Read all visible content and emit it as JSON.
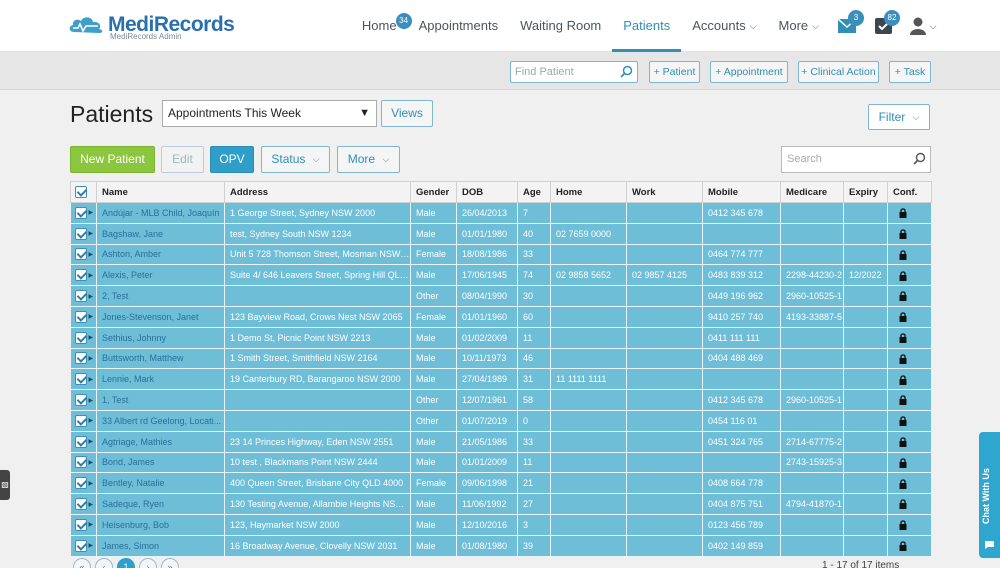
{
  "app": {
    "brand": "MediRecords",
    "brand_sub": "MediRecords Admin"
  },
  "nav": {
    "items": [
      {
        "label": "Home",
        "badge": "34"
      },
      {
        "label": "Appointments"
      },
      {
        "label": "Waiting Room"
      },
      {
        "label": "Patients",
        "active": true
      },
      {
        "label": "Accounts",
        "dropdown": true
      },
      {
        "label": "More",
        "dropdown": true
      }
    ],
    "mail_badge": "3",
    "tasks_badge": "82"
  },
  "actionbar": {
    "find_placeholder": "Find Patient",
    "buttons": [
      "+ Patient",
      "+ Appointment",
      "+ Clinical Action",
      "+ Task"
    ]
  },
  "page": {
    "title": "Patients",
    "view_selected": "Appointments This Week",
    "views_label": "Views",
    "filter_label": "Filter"
  },
  "toolbar": {
    "new_patient": "New Patient",
    "edit": "Edit",
    "opv": "OPV",
    "status": "Status",
    "more": "More",
    "search_placeholder": "Search"
  },
  "table": {
    "headers": [
      "Name",
      "Address",
      "Gender",
      "DOB",
      "Age",
      "Home",
      "Work",
      "Mobile",
      "Medicare",
      "Expiry",
      "Conf."
    ],
    "rows": [
      {
        "name": "Andújar - MLB Child, Joaquín",
        "address": "1 George Street, Sydney NSW 2000",
        "gender": "Male",
        "dob": "26/04/2013",
        "age": "7",
        "home": "",
        "work": "",
        "mobile": "0412 345 678",
        "medicare": "",
        "expiry": ""
      },
      {
        "name": "Bagshaw, Jane",
        "address": "test, Sydney South NSW 1234",
        "gender": "Male",
        "dob": "01/01/1980",
        "age": "40",
        "home": "02 7659 0000",
        "work": "",
        "mobile": "",
        "medicare": "",
        "expiry": ""
      },
      {
        "name": "Ashton, Amber",
        "address": "Unit 5 728 Thomson Street, Mosman NSW ...",
        "gender": "Female",
        "dob": "18/08/1986",
        "age": "33",
        "home": "",
        "work": "",
        "mobile": "0464 774 777",
        "medicare": "",
        "expiry": ""
      },
      {
        "name": "Alexis, Peter",
        "address": "Suite 4/ 646 Leavers Street, Spring Hill QLD ...",
        "gender": "Male",
        "dob": "17/06/1945",
        "age": "74",
        "home": "02 9858 5652",
        "work": "02 9857 4125",
        "mobile": "0483 839 312",
        "medicare": "2298-44230-2",
        "expiry": "12/2022"
      },
      {
        "name": "2, Test",
        "address": "",
        "gender": "Other",
        "dob": "08/04/1990",
        "age": "30",
        "home": "",
        "work": "",
        "mobile": "0449 196 962",
        "medicare": "2960-10525-1",
        "expiry": ""
      },
      {
        "name": "Jones-Stevenson, Janet",
        "address": "123 Bayview Road, Crows Nest NSW 2065",
        "gender": "Female",
        "dob": "01/01/1960",
        "age": "60",
        "home": "",
        "work": "",
        "mobile": "9410 257 740",
        "medicare": "4193-33887-5",
        "expiry": ""
      },
      {
        "name": "Sethius, Johnny",
        "address": "1 Demo St, Picnic Point NSW 2213",
        "gender": "Male",
        "dob": "01/02/2009",
        "age": "11",
        "home": "",
        "work": "",
        "mobile": "0411 111 111",
        "medicare": "",
        "expiry": ""
      },
      {
        "name": "Buttsworth, Matthew",
        "address": "1 Smith Street, Smithfield NSW 2164",
        "gender": "Male",
        "dob": "10/11/1973",
        "age": "46",
        "home": "",
        "work": "",
        "mobile": "0404 488 469",
        "medicare": "",
        "expiry": ""
      },
      {
        "name": "Lennie, Mark",
        "address": "19 Canterbury RD, Barangaroo NSW 2000",
        "gender": "Male",
        "dob": "27/04/1989",
        "age": "31",
        "home": "11 1111 1111",
        "work": "",
        "mobile": "",
        "medicare": "",
        "expiry": ""
      },
      {
        "name": "1, Test",
        "address": "",
        "gender": "Other",
        "dob": "12/07/1961",
        "age": "58",
        "home": "",
        "work": "",
        "mobile": "0412 345 678",
        "medicare": "2960-10525-1",
        "expiry": ""
      },
      {
        "name": "33 Albert rd Geelong, Locati...",
        "address": "",
        "gender": "Other",
        "dob": "01/07/2019",
        "age": "0",
        "home": "",
        "work": "",
        "mobile": "0454 116 01",
        "medicare": "",
        "expiry": ""
      },
      {
        "name": "Agtriage, Mathies",
        "address": "23 14 Princes Highway, Eden NSW 2551",
        "gender": "Male",
        "dob": "21/05/1986",
        "age": "33",
        "home": "",
        "work": "",
        "mobile": "0451 324 765",
        "medicare": "2714-67775-2",
        "expiry": ""
      },
      {
        "name": "Bond, James",
        "address": "10 test , Blackmans Point NSW 2444",
        "gender": "Male",
        "dob": "01/01/2009",
        "age": "11",
        "home": "",
        "work": "",
        "mobile": "",
        "medicare": "2743-15925-3",
        "expiry": ""
      },
      {
        "name": "Bentley, Natalie",
        "address": "400 Queen Street, Brisbane City QLD 4000",
        "gender": "Female",
        "dob": "09/06/1998",
        "age": "21",
        "home": "",
        "work": "",
        "mobile": "0408 664 778",
        "medicare": "",
        "expiry": ""
      },
      {
        "name": "Sadeque, Ryen",
        "address": "130 Testing Avenue, Allambie Heights NSW ...",
        "gender": "Male",
        "dob": "11/06/1992",
        "age": "27",
        "home": "",
        "work": "",
        "mobile": "0404 875 751",
        "medicare": "4794-41870-1",
        "expiry": ""
      },
      {
        "name": "Heisenburg, Bob",
        "address": "123, Haymarket NSW 2000",
        "gender": "Male",
        "dob": "12/10/2016",
        "age": "3",
        "home": "",
        "work": "",
        "mobile": "0123 456 789",
        "medicare": "",
        "expiry": ""
      },
      {
        "name": "James, Simon",
        "address": "16 Broadway Avenue, Clovelly NSW 2031",
        "gender": "Male",
        "dob": "01/08/1980",
        "age": "39",
        "home": "",
        "work": "",
        "mobile": "0402 149 859",
        "medicare": "",
        "expiry": ""
      }
    ]
  },
  "pagination": {
    "pages": [
      "«",
      "‹",
      "1",
      "›",
      "»"
    ],
    "active": "1",
    "items_label": "1 - 17 of 17 items"
  },
  "chat": {
    "label": "Chat With Us"
  },
  "colors": {
    "accent": "#2f9fc9",
    "row": "#6fbed8",
    "new_button": "#8cc63f"
  }
}
